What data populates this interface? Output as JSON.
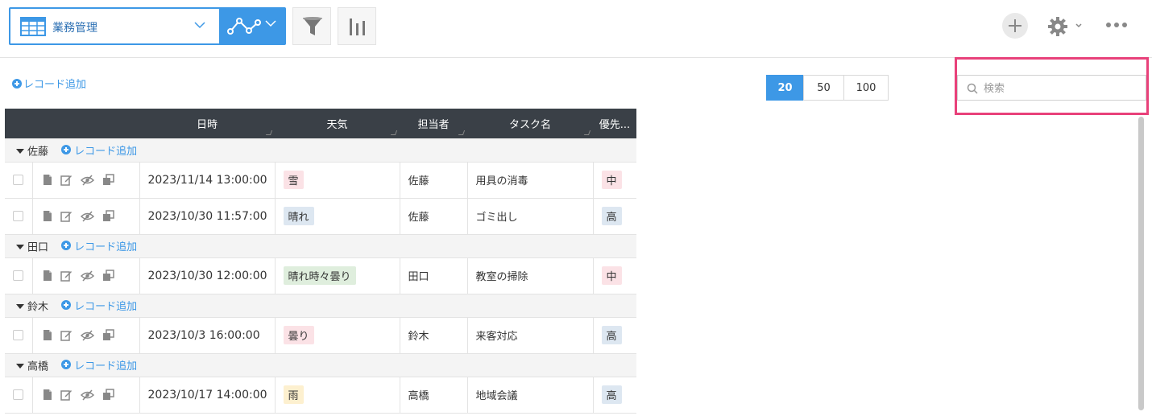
{
  "toolbar": {
    "view_name": "業務管理"
  },
  "add_record_label": "レコード追加",
  "pager": {
    "options": [
      "20",
      "50",
      "100"
    ],
    "selected": "20"
  },
  "search": {
    "placeholder": "検索"
  },
  "table": {
    "columns": [
      "日時",
      "天気",
      "担当者",
      "タスク名",
      "優先..."
    ],
    "groups": [
      {
        "name": "佐藤",
        "add_label": "レコード追加",
        "rows": [
          {
            "date": "2023/11/14 13:00:00",
            "weather": "雪",
            "weather_color": "#fbe2e6",
            "owner": "佐藤",
            "task": "用具の消毒",
            "priority": "中",
            "priority_color": "#fbe2e6"
          },
          {
            "date": "2023/10/30 11:57:00",
            "weather": "晴れ",
            "weather_color": "#dde7f1",
            "owner": "佐藤",
            "task": "ゴミ出し",
            "priority": "高",
            "priority_color": "#dde7f1"
          }
        ]
      },
      {
        "name": "田口",
        "add_label": "レコード追加",
        "rows": [
          {
            "date": "2023/10/30 12:00:00",
            "weather": "晴れ時々曇り",
            "weather_color": "#dfeedd",
            "owner": "田口",
            "task": "教室の掃除",
            "priority": "中",
            "priority_color": "#fbe2e6"
          }
        ]
      },
      {
        "name": "鈴木",
        "add_label": "レコード追加",
        "rows": [
          {
            "date": "2023/10/3 16:00:00",
            "weather": "曇り",
            "weather_color": "#fbe2e6",
            "owner": "鈴木",
            "task": "来客対応",
            "priority": "高",
            "priority_color": "#dde7f1"
          }
        ]
      },
      {
        "name": "高橋",
        "add_label": "レコード追加",
        "rows": [
          {
            "date": "2023/10/17 14:00:00",
            "weather": "雨",
            "weather_color": "#fdf0cf",
            "owner": "高橋",
            "task": "地域会議",
            "priority": "高",
            "priority_color": "#dde7f1"
          }
        ]
      }
    ]
  }
}
